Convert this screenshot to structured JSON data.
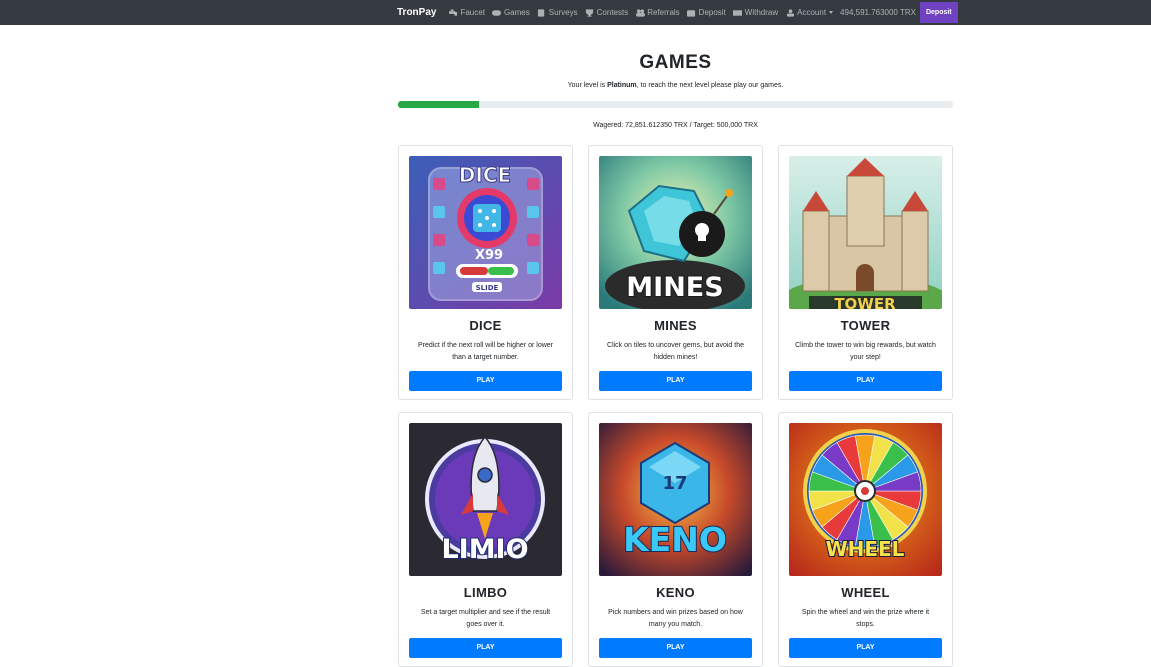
{
  "navbar": {
    "brand": "TronPay",
    "links": [
      {
        "label": "Faucet",
        "icon": "faucet-icon"
      },
      {
        "label": "Games",
        "icon": "gamepad-icon"
      },
      {
        "label": "Surveys",
        "icon": "survey-icon"
      },
      {
        "label": "Contests",
        "icon": "trophy-icon"
      },
      {
        "label": "Referrals",
        "icon": "users-icon"
      }
    ],
    "right_links": [
      {
        "label": "Deposit",
        "icon": "wallet-icon"
      },
      {
        "label": "Withdraw",
        "icon": "money-icon"
      },
      {
        "label": "Account",
        "icon": "user-icon"
      }
    ],
    "balance": "494,591.763000 TRX",
    "deposit_button": "Deposit"
  },
  "main": {
    "title": "GAMES",
    "level_prefix": "Your level is ",
    "level_name": "Platinum",
    "level_suffix": ", to reach the next level please play our games.",
    "progress_fraction": 0.1457,
    "wagered": "Wagered: 72,851.612350 TRX / Target: 500,000 TRX"
  },
  "games": [
    {
      "name": "DICE",
      "desc": "Predict if the next roll will be higher or lower than a target number.",
      "button": "PLAY",
      "art_text": "DICE",
      "art_sub": "X99",
      "art_label": "SLIDE"
    },
    {
      "name": "MINES",
      "desc": "Click on tiles to uncover gems, but avoid the hidden mines!",
      "button": "PLAY",
      "art_text": "MINES"
    },
    {
      "name": "TOWER",
      "desc": "Climb the tower to win big rewards, but watch your step!",
      "button": "PLAY",
      "art_text": "TOWER"
    },
    {
      "name": "LIMBO",
      "desc": "Set a target multiplier and see if the result goes over it.",
      "button": "PLAY",
      "art_text": "LIMIO"
    },
    {
      "name": "KENO",
      "desc": "Pick numbers and win prizes based on how many you match.",
      "button": "PLAY",
      "art_text": "KENO",
      "art_sub": "17"
    },
    {
      "name": "WHEEL",
      "desc": "Spin the wheel and win the prize where it stops.",
      "button": "PLAY",
      "art_text": "WHEEL"
    }
  ],
  "colors": {
    "navbar_bg": "#343a40",
    "deposit_bg": "#6f42c1",
    "progress_fill": "#28a745",
    "play_button": "#007bff"
  }
}
